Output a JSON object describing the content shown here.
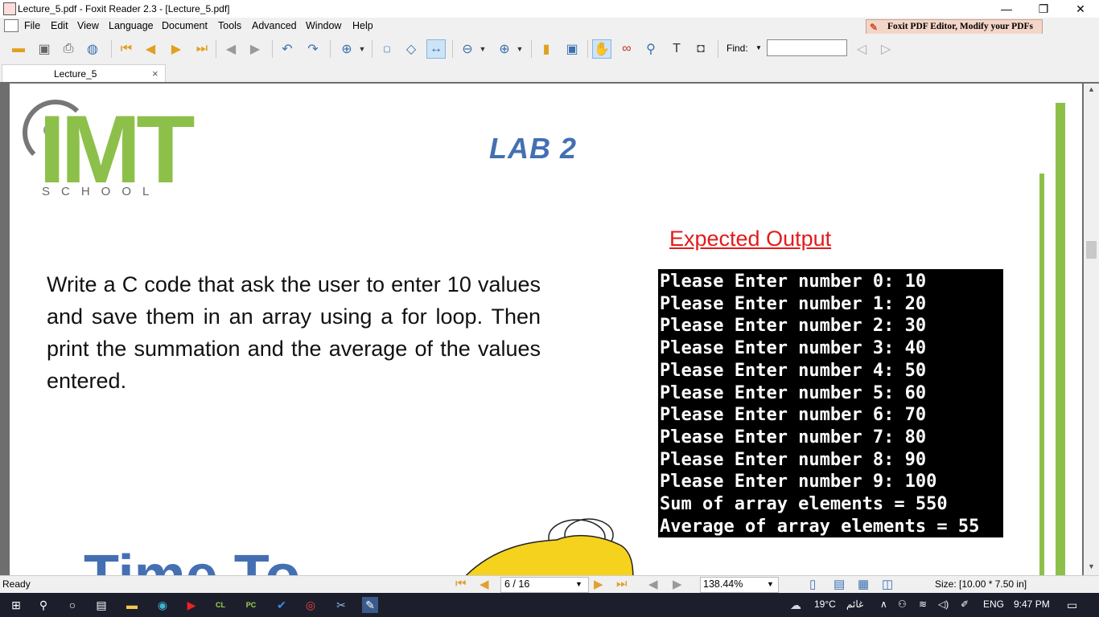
{
  "window": {
    "title": "Lecture_5.pdf - Foxit Reader 2.3 - [Lecture_5.pdf]",
    "minimize": "—",
    "restore": "❐",
    "close": "✕"
  },
  "menu": {
    "items": [
      "File",
      "Edit",
      "View",
      "Language",
      "Document",
      "Tools",
      "Advanced",
      "Window",
      "Help"
    ],
    "promo": "Foxit PDF Editor, Modify your PDFs"
  },
  "toolbar": {
    "find_label": "Find:",
    "find_value": ""
  },
  "tabs": {
    "active_label": "Lecture_5",
    "close": "×"
  },
  "page": {
    "logo_text": "IMT",
    "logo_subtext": "SCHOOL",
    "heading": "LAB 2",
    "expected_label": "Expected Output",
    "task": "Write a C code that ask the user to enter 10 values and save them in an array using a for loop. Then print the summation and the average of the values entered.",
    "console_lines": [
      "Please Enter number 0: 10",
      "Please Enter number 1: 20",
      "Please Enter number 2: 30",
      "Please Enter number 3: 40",
      "Please Enter number 4: 50",
      "Please Enter number 5: 60",
      "Please Enter number 6: 70",
      "Please Enter number 7: 80",
      "Please Enter number 8: 90",
      "Please Enter number 9: 100",
      "Sum of array elements = 550",
      "Average of array elements = 55"
    ],
    "footer_text": "Time To"
  },
  "status": {
    "ready": "Ready",
    "page_indicator": "6 / 16",
    "zoom": "138.44%",
    "size": "Size: [10.00 * 7.50 in]"
  },
  "taskbar": {
    "weather": "19°C",
    "weather_desc": "غائم",
    "lang": "ENG",
    "time": "9:47 PM"
  },
  "colors": {
    "brand_green": "#8dc04a",
    "lab_blue": "#4470b3",
    "expected_red": "#e21b1b"
  }
}
